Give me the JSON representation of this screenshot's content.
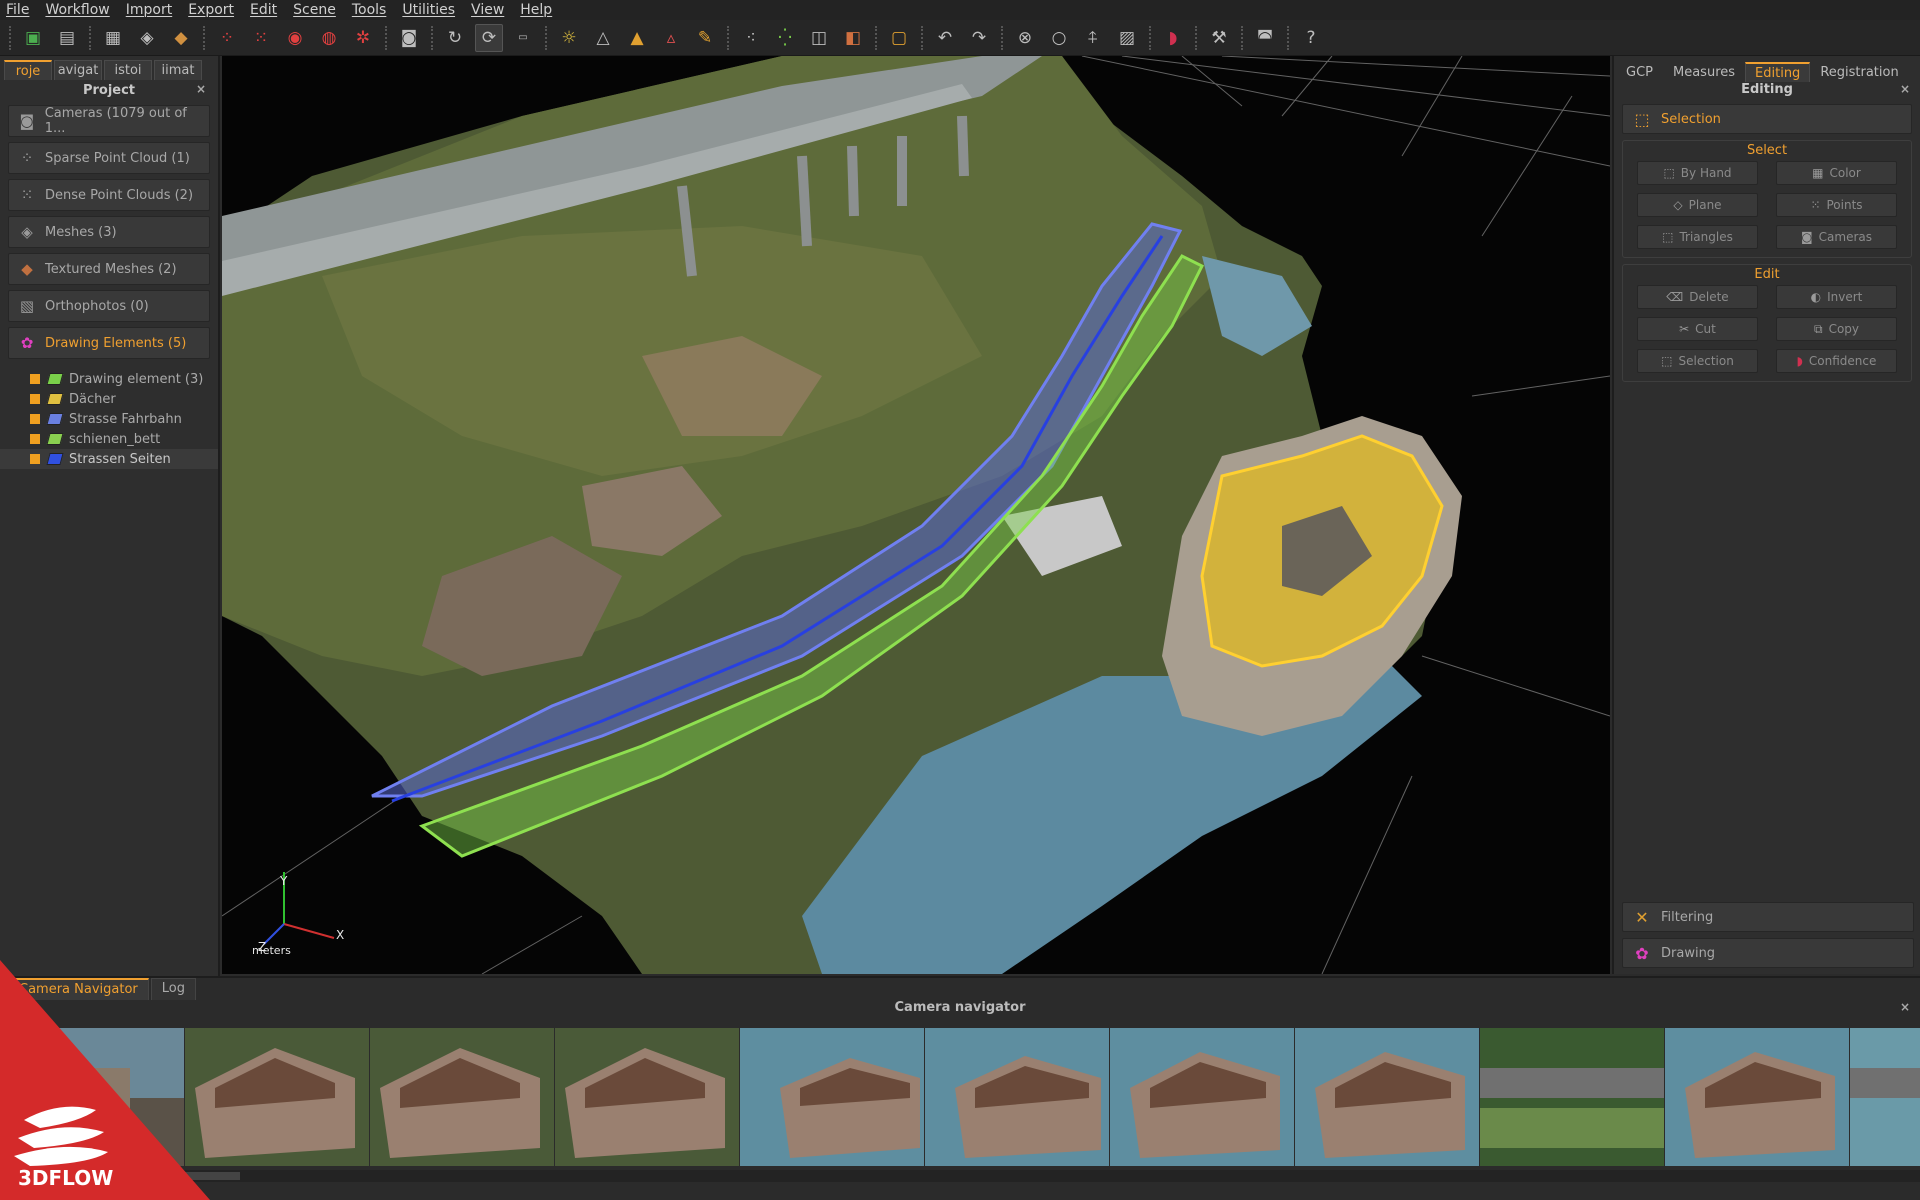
{
  "menubar": [
    "File",
    "Workflow",
    "Import",
    "Export",
    "Edit",
    "Scene",
    "Tools",
    "Utilities",
    "View",
    "Help"
  ],
  "toolbar_icons": [
    "new-project-icon",
    "save-icon",
    "orthophoto-icon",
    "mesh-icon",
    "textured-mesh-icon",
    "sparse-icon",
    "dense-icon",
    "mesh-gen-icon",
    "texture-gen-icon",
    "structure-icon",
    "camera-icon",
    "orbit-icon",
    "rotate-icon",
    "wasd-icon",
    "light-icon",
    "measure-icon",
    "point-icon",
    "triangle-icon",
    "brush-icon",
    "select-points-icon",
    "select-dense-icon",
    "box-icon",
    "cube-icon",
    "bounding-box-icon",
    "undo-icon",
    "redo-icon",
    "gizmo-icon",
    "circle-icon",
    "up-axis-icon",
    "grid-icon",
    "magnet-icon",
    "tool-icon",
    "mask-icon",
    "help-icon"
  ],
  "left": {
    "tabs": [
      "roje",
      "avigat",
      "istoi",
      "iimat"
    ],
    "header": "Project",
    "close": "×",
    "items": [
      {
        "label": "Cameras (1079 out of 1...",
        "icon": "camera-icon"
      },
      {
        "label": "Sparse Point Cloud (1)",
        "icon": "sparse-cloud-icon"
      },
      {
        "label": "Dense Point Clouds (2)",
        "icon": "dense-cloud-icon"
      },
      {
        "label": "Meshes (3)",
        "icon": "mesh-icon"
      },
      {
        "label": "Textured Meshes (2)",
        "icon": "textured-mesh-icon"
      },
      {
        "label": "Orthophotos (0)",
        "icon": "orthophoto-icon"
      },
      {
        "label": "Drawing Elements (5)",
        "icon": "drawing-icon"
      }
    ],
    "tree": [
      {
        "label": "Drawing element (3)",
        "color": "#7ad04a"
      },
      {
        "label": "Dächer",
        "color": "#e0c040"
      },
      {
        "label": "Strasse Fahrbahn",
        "color": "#6a80e0"
      },
      {
        "label": "schienen_bett",
        "color": "#8ad050"
      },
      {
        "label": "Strassen Seiten",
        "color": "#3050e0"
      }
    ]
  },
  "viewport": {
    "axis_y": "Y",
    "axis_x": "X",
    "axis_z": "Z",
    "units": "meters"
  },
  "right": {
    "tabs": [
      "GCP",
      "Measures",
      "Editing",
      "Registration"
    ],
    "header": "Editing",
    "close": "×",
    "selection_label": "Selection",
    "select_group": {
      "title": "Select",
      "buttons": [
        "By Hand",
        "Color",
        "Plane",
        "Points",
        "Triangles",
        "Cameras"
      ]
    },
    "edit_group": {
      "title": "Edit",
      "buttons": [
        "Delete",
        "Invert",
        "Cut",
        "Copy",
        "Selection",
        "Confidence"
      ]
    },
    "filtering_label": "Filtering",
    "drawing_label": "Drawing"
  },
  "camera_nav": {
    "tabs": [
      "Camera Navigator",
      "Log"
    ],
    "header": "Camera navigator",
    "close": "×"
  },
  "brand": {
    "name": "3DFLOW",
    "color": "#d42a2a"
  }
}
